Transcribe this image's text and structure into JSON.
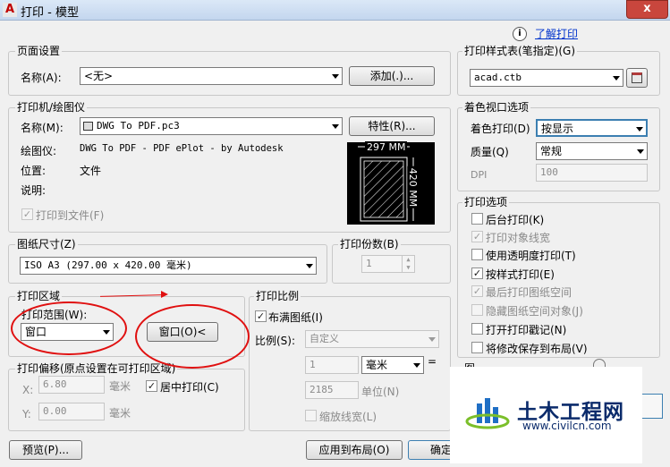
{
  "window": {
    "title": "打印 - 模型",
    "close": "x"
  },
  "help": {
    "icon": "i",
    "link": "了解打印"
  },
  "page_setup": {
    "legend": "页面设置",
    "name_label": "名称(A):",
    "name_value": "<无>",
    "add_button": "添加(.)..."
  },
  "printer": {
    "legend": "打印机/绘图仪",
    "name_label": "名称(M):",
    "name_value": "DWG To PDF.pc3",
    "props_button": "特性(R)...",
    "plotter_label": "绘图仪:",
    "plotter_value": "DWG To PDF - PDF ePlot - by Autodesk",
    "where_label": "位置:",
    "where_value": "文件",
    "desc_label": "说明:",
    "print_to_file": "打印到文件(F)",
    "print_to_file_checked": true,
    "preview_width": "297 MM",
    "preview_height": "420 MM"
  },
  "paper": {
    "legend": "图纸尺寸(Z)",
    "value": "ISO A3 (297.00 x 420.00 毫米)"
  },
  "copies": {
    "legend": "打印份数(B)",
    "value": "1"
  },
  "area": {
    "legend": "打印区域",
    "range_label": "打印范围(W):",
    "range_value": "窗口",
    "window_button": "窗口(O)<"
  },
  "offset": {
    "legend": "打印偏移(原点设置在可打印区域)",
    "x_label": "X:",
    "x_value": "6.80",
    "x_unit": "毫米",
    "y_label": "Y:",
    "y_value": "0.00",
    "y_unit": "毫米",
    "center_label": "居中打印(C)",
    "center_checked": true
  },
  "scale": {
    "legend": "打印比例",
    "fit_label": "布满图纸(I)",
    "fit_checked": true,
    "scale_label": "比例(S):",
    "scale_value": "自定义",
    "value1": "1",
    "unit_value": "毫米",
    "equals": "=",
    "value2": "2185",
    "unit2": "单位(N)",
    "lineweights_label": "缩放线宽(L)"
  },
  "style_table": {
    "legend": "打印样式表(笔指定)(G)",
    "value": "acad.ctb"
  },
  "shaded": {
    "legend": "着色视口选项",
    "shade_label": "着色打印(D)",
    "shade_value": "按显示",
    "quality_label": "质量(Q)",
    "quality_value": "常规",
    "dpi_label": "DPI",
    "dpi_value": "100"
  },
  "options": {
    "legend": "打印选项",
    "items": [
      {
        "label": "后台打印(K)",
        "checked": false,
        "disabled": false
      },
      {
        "label": "打印对象线宽",
        "checked": true,
        "disabled": true
      },
      {
        "label": "使用透明度打印(T)",
        "checked": false,
        "disabled": false
      },
      {
        "label": "按样式打印(E)",
        "checked": true,
        "disabled": false
      },
      {
        "label": "最后打印图纸空间",
        "checked": true,
        "disabled": true
      },
      {
        "label": "隐藏图纸空间对象(J)",
        "checked": false,
        "disabled": true
      },
      {
        "label": "打开打印戳记(N)",
        "checked": false,
        "disabled": false
      },
      {
        "label": "将修改保存到布局(V)",
        "checked": false,
        "disabled": false
      }
    ],
    "partial_label": "图"
  },
  "footer": {
    "preview_button": "预览(P)...",
    "apply_button": "应用到布局(O)",
    "ok_button": "确定"
  },
  "watermark": {
    "text": "土木工程网",
    "url": "www.civilcn.com"
  },
  "colors": {
    "annotation": "#e01010",
    "watermark_text": "#0b2b6b",
    "watermark_logo": "#1f6fc5"
  }
}
